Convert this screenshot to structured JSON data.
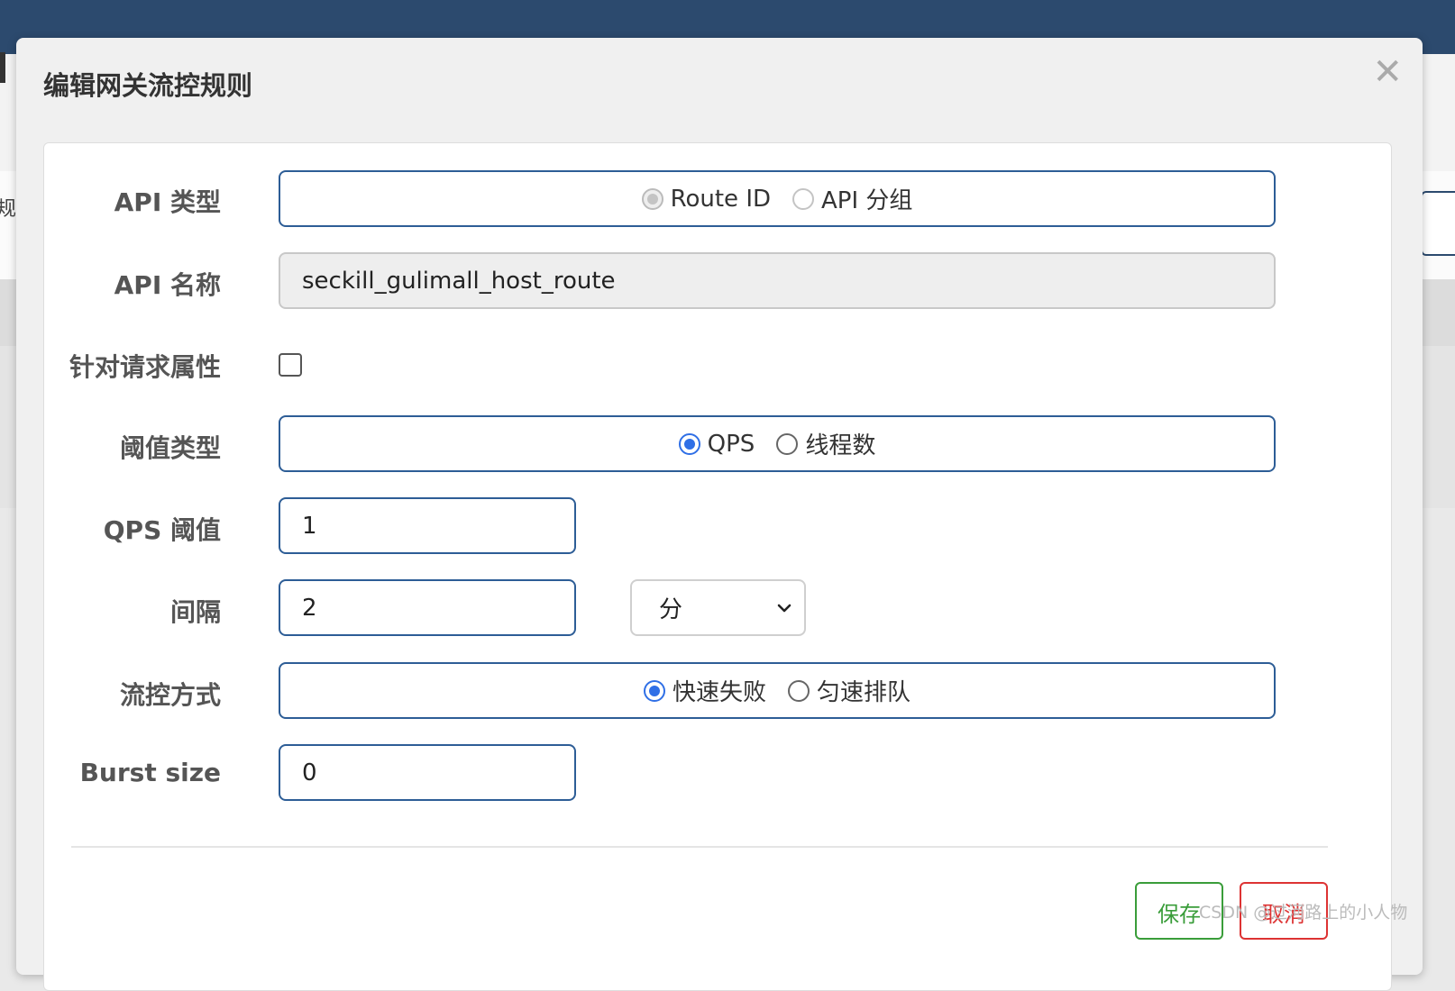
{
  "background": {
    "left_char": "规"
  },
  "modal": {
    "title": "编辑网关流控规则",
    "close_glyph": "✕"
  },
  "form": {
    "api_type": {
      "label": "API 类型",
      "options": [
        "Route ID",
        "API 分组"
      ],
      "selected": "Route ID"
    },
    "api_name": {
      "label": "API 名称",
      "value": "seckill_gulimall_host_route"
    },
    "request_attr": {
      "label": "针对请求属性",
      "checked": false
    },
    "threshold_type": {
      "label": "阈值类型",
      "options": [
        "QPS",
        "线程数"
      ],
      "selected": "QPS"
    },
    "qps_threshold": {
      "label": "QPS 阈值",
      "value": "1"
    },
    "interval": {
      "label": "间隔",
      "value": "2",
      "unit": "分"
    },
    "control_behavior": {
      "label": "流控方式",
      "options": [
        "快速失败",
        "匀速排队"
      ],
      "selected": "快速失败"
    },
    "burst_size": {
      "label": "Burst size",
      "value": "0"
    }
  },
  "footer": {
    "save_label": "保存",
    "cancel_label": "取消"
  },
  "watermark": "CSDN @过河路上的小人物",
  "colors": {
    "topbar": "#2c4a6e",
    "input_border": "#2d5d96",
    "radio_checked": "#2f6fe6",
    "save": "#3a9d3a",
    "cancel": "#dd3333"
  }
}
